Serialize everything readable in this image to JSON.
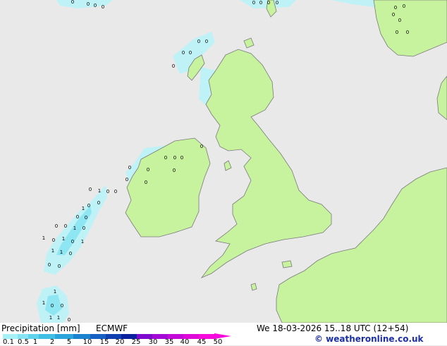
{
  "footer": {
    "variable": "Precipitation [mm]",
    "model": "ECMWF",
    "valid_time": "We 18-03-2026 15..18 UTC (12+54)",
    "credit": "© weatheronline.co.uk"
  },
  "legend": {
    "ticks": [
      "0.1",
      "0.5",
      "1",
      "2",
      "5",
      "10",
      "15",
      "20",
      "25",
      "30",
      "35",
      "40",
      "45",
      "50"
    ],
    "colors": [
      "#a8f0f8",
      "#86e4f2",
      "#5fd2ec",
      "#3fbfe4",
      "#2aa4da",
      "#1a82cf",
      "#1560c2",
      "#1040b0",
      "#0a209e",
      "#7e0ad0",
      "#a30ad6",
      "#c40ad8",
      "#e00ad8",
      "#f60adc"
    ]
  },
  "colors": {
    "sea": "#e9e9ea",
    "land": "#c7f29e",
    "coast": "#7a7a7a",
    "rain_light": "#bff2f6",
    "rain_mid": "#8ee6f2"
  },
  "map_labels": [
    "0",
    "0",
    "0",
    "0",
    "0",
    "0",
    "0",
    "0",
    "0",
    "0",
    "0",
    "0",
    "0",
    "0",
    "0",
    "0",
    "0",
    "0",
    "0",
    "0",
    "0",
    "0",
    "0",
    "0",
    "0",
    "0",
    "0",
    "0",
    "0",
    "1",
    "0",
    "0",
    "0",
    "0",
    "0",
    "0",
    "0",
    "0",
    "1",
    "0",
    "1",
    "0",
    "0",
    "1",
    "1",
    "1",
    "0",
    "0",
    "0",
    "1",
    "1",
    "0",
    "0",
    "1",
    "1",
    "0",
    "1",
    "1"
  ]
}
